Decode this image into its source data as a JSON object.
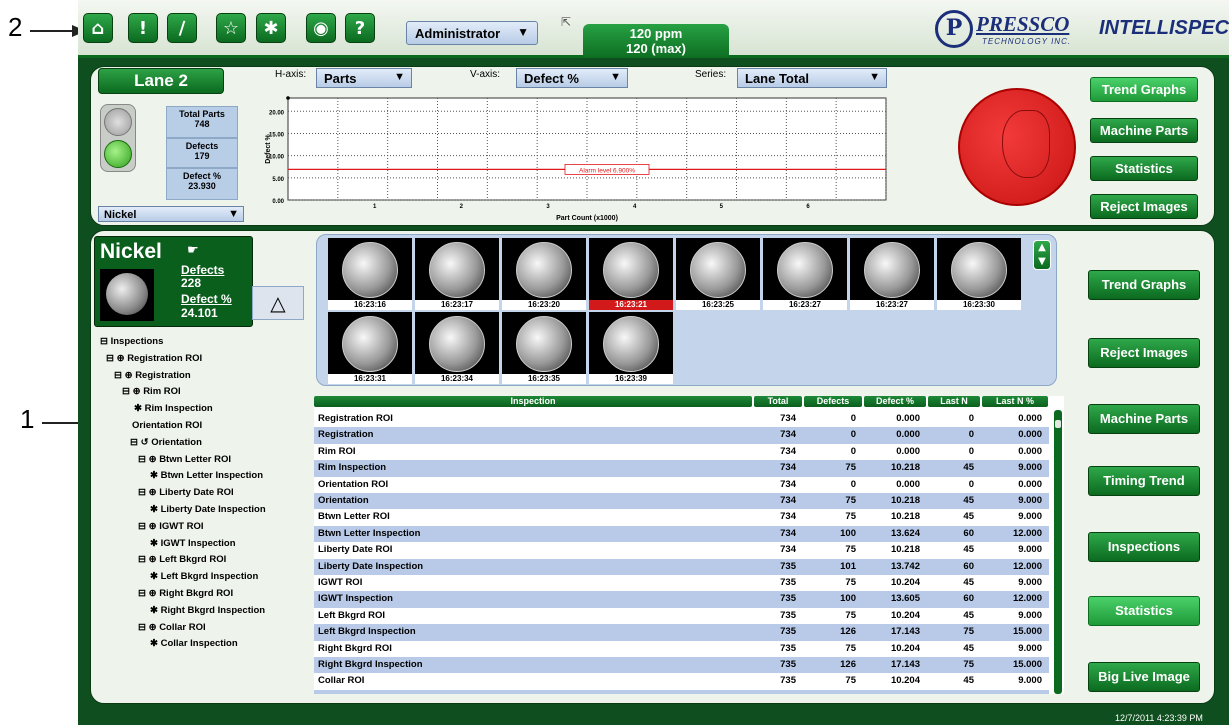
{
  "callouts": {
    "one": "1",
    "two": "2"
  },
  "toolbar": {
    "home_icon": "⌂",
    "alert_icon": "!",
    "tools_icon": "∕",
    "star_icon": "☆",
    "wand_icon": "✱",
    "globe_icon": "◉",
    "help_icon": "?",
    "user": "Administrator",
    "caret": "▼",
    "cursor_icon": "⇱",
    "ppm": "120 ppm",
    "ppm_max": "120 (max)",
    "logo_emblem": "P",
    "logo_brand": "PRESSCO",
    "logo_sub": "TECHNOLOGY INC.",
    "logo_product": "INTELLISPEC"
  },
  "top_panel": {
    "lane": "Lane 2",
    "stats": [
      {
        "label": "Total Parts",
        "value": "748"
      },
      {
        "label": "Defects",
        "value": "179"
      },
      {
        "label": "Defect %",
        "value": "23.930"
      }
    ],
    "part_select": "Nickel",
    "h_axis_label": "H-axis:",
    "h_axis_value": "Parts",
    "v_axis_label": "V-axis:",
    "v_axis_value": "Defect %",
    "series_label": "Series:",
    "series_value": "Lane Total"
  },
  "chart_data": {
    "type": "line",
    "xlabel": "Part Count (x1000)",
    "ylabel": "Defect %",
    "x_ticks": [
      "1",
      "2",
      "3",
      "4",
      "5",
      "6"
    ],
    "y_ticks": [
      "0.00",
      "5.00",
      "10.00",
      "15.00",
      "20.00"
    ],
    "xlim": [
      0,
      6.9
    ],
    "ylim": [
      0,
      23
    ],
    "alarm_level": 6.9,
    "alarm_label": "Alarm level 6.900%",
    "grid": true
  },
  "right_buttons_top": [
    "Trend Graphs",
    "Machine Parts",
    "Statistics",
    "Reject Images"
  ],
  "right_buttons_main": [
    "Trend Graphs",
    "Reject Images",
    "Machine Parts",
    "Timing Trend",
    "Inspections",
    "Statistics",
    "Big Live Image"
  ],
  "nickel_box": {
    "title": "Nickel",
    "defects_label": "Defects",
    "defects_value": "228",
    "defect_pct_label": "Defect %",
    "defect_pct_value": "24.101",
    "hand_icon": "☛",
    "compass_icon": "△"
  },
  "tree": [
    "⊟ Inspections",
    "⊟ ⊕ Registration ROI",
    "⊟ ⊕ Registration",
    "⊟ ⊕ Rim ROI",
    "✱ Rim Inspection",
    "Orientation ROI",
    "⊟ ↺ Orientation",
    "⊟ ⊕ Btwn Letter ROI",
    "✱ Btwn Letter Inspection",
    "⊟ ⊕ Liberty Date ROI",
    "✱ Liberty Date Inspection",
    "⊟ ⊕ IGWT ROI",
    "✱ IGWT Inspection",
    "⊟ ⊕ Left Bkgrd ROI",
    "✱ Left Bkgrd Inspection",
    "⊟ ⊕ Right Bkgrd ROI",
    "✱ Right Bkgrd Inspection",
    "⊟ ⊕ Collar ROI",
    "✱ Collar Inspection"
  ],
  "thumbnails": [
    {
      "time": "16:23:16",
      "flag": false
    },
    {
      "time": "16:23:17",
      "flag": false
    },
    {
      "time": "16:23:20",
      "flag": false
    },
    {
      "time": "16:23:21",
      "flag": true
    },
    {
      "time": "16:23:25",
      "flag": false
    },
    {
      "time": "16:23:27",
      "flag": false
    },
    {
      "time": "16:23:27",
      "flag": false
    },
    {
      "time": "16:23:30",
      "flag": false
    },
    {
      "time": "16:23:31",
      "flag": false
    },
    {
      "time": "16:23:34",
      "flag": false
    },
    {
      "time": "16:23:35",
      "flag": false
    },
    {
      "time": "16:23:39",
      "flag": false
    }
  ],
  "table": {
    "headers": [
      "Inspection",
      "Total",
      "Defects",
      "Defect %",
      "Last N",
      "Last N %"
    ],
    "rows": [
      [
        "Registration ROI",
        "734",
        "0",
        "0.000",
        "0",
        "0.000"
      ],
      [
        "Registration",
        "734",
        "0",
        "0.000",
        "0",
        "0.000"
      ],
      [
        "Rim ROI",
        "734",
        "0",
        "0.000",
        "0",
        "0.000"
      ],
      [
        "Rim Inspection",
        "734",
        "75",
        "10.218",
        "45",
        "9.000"
      ],
      [
        "Orientation ROI",
        "734",
        "0",
        "0.000",
        "0",
        "0.000"
      ],
      [
        "Orientation",
        "734",
        "75",
        "10.218",
        "45",
        "9.000"
      ],
      [
        "Btwn Letter ROI",
        "734",
        "75",
        "10.218",
        "45",
        "9.000"
      ],
      [
        "Btwn Letter Inspection",
        "734",
        "100",
        "13.624",
        "60",
        "12.000"
      ],
      [
        "Liberty Date ROI",
        "734",
        "75",
        "10.218",
        "45",
        "9.000"
      ],
      [
        "Liberty Date Inspection",
        "735",
        "101",
        "13.742",
        "60",
        "12.000"
      ],
      [
        "IGWT ROI",
        "735",
        "75",
        "10.204",
        "45",
        "9.000"
      ],
      [
        "IGWT Inspection",
        "735",
        "100",
        "13.605",
        "60",
        "12.000"
      ],
      [
        "Left Bkgrd ROI",
        "735",
        "75",
        "10.204",
        "45",
        "9.000"
      ],
      [
        "Left Bkgrd Inspection",
        "735",
        "126",
        "17.143",
        "75",
        "15.000"
      ],
      [
        "Right Bkgrd ROI",
        "735",
        "75",
        "10.204",
        "45",
        "9.000"
      ],
      [
        "Right Bkgrd Inspection",
        "735",
        "126",
        "17.143",
        "75",
        "15.000"
      ],
      [
        "Collar ROI",
        "735",
        "75",
        "10.204",
        "45",
        "9.000"
      ]
    ]
  },
  "timestamp": "12/7/2011 4:23:39 PM",
  "colors": {
    "brand_green": "#0b6a1f",
    "alarm_red": "#e01818",
    "row_alt": "#b8cae8"
  }
}
